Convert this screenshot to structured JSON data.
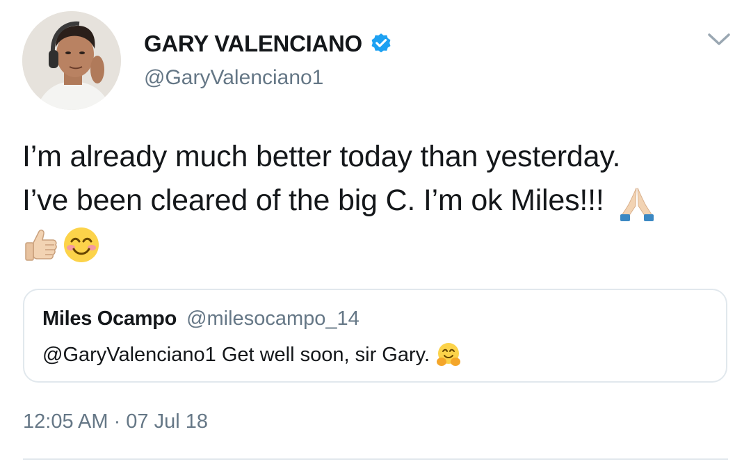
{
  "author": {
    "name": "GARY VALENCIANO",
    "handle": "@GaryValenciano1",
    "verified": true
  },
  "tweet": {
    "line1": "I’m already much better today than yesterday.",
    "line2": "I’ve been cleared of the big C. I’m ok Miles!!!",
    "emojis": [
      "folded-hands-emoji",
      "thumbs-up-emoji",
      "smiling-face-emoji"
    ]
  },
  "quoted_tweet": {
    "name": "Miles Ocampo",
    "handle": "@milesocampo_14",
    "text": "@GaryValenciano1 Get well soon, sir Gary.",
    "emoji": "hugging-face-emoji"
  },
  "meta": {
    "timestamp": "12:05 AM · 07 Jul 18"
  },
  "colors": {
    "text": "#14171a",
    "secondary": "#657786",
    "verified_blue": "#1da1f2",
    "border": "#e1e8ed"
  },
  "icons": {
    "verified": "verified-badge-icon",
    "more": "chevron-down-icon"
  }
}
